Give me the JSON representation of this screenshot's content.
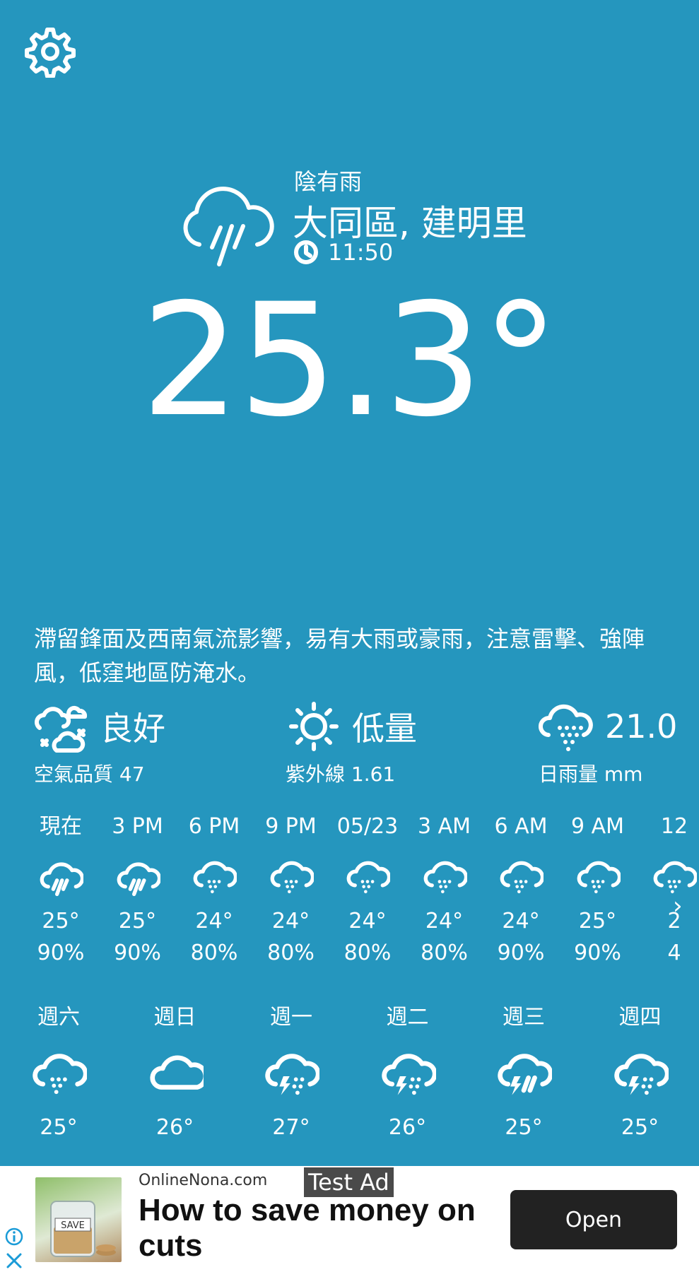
{
  "header": {
    "settings_icon": "gear-icon"
  },
  "current": {
    "condition": "陰有雨",
    "location": "大同區, 建明里",
    "time": "11:50",
    "temperature": "25.3°",
    "icon": "cloud-rain-icon"
  },
  "forecast_text": "滯留鋒面及西南氣流影響，易有大雨或豪雨，注意雷擊、強陣風，低窪地區防淹水。",
  "stats": {
    "air_quality": {
      "value": "良好",
      "label": "空氣品質 47",
      "icon": "air-quality-icon"
    },
    "uv": {
      "value": "低量",
      "label": "紫外線 1.61",
      "icon": "sun-icon"
    },
    "rain": {
      "value": "21.0",
      "label": "日雨量 mm",
      "icon": "cloud-rain-dots-icon"
    }
  },
  "hourly": [
    {
      "time": "現在",
      "temp": "25°",
      "pop": "90%",
      "icon": "cloud-rain-icon"
    },
    {
      "time": "3 PM",
      "temp": "25°",
      "pop": "90%",
      "icon": "cloud-rain-icon"
    },
    {
      "time": "6 PM",
      "temp": "24°",
      "pop": "80%",
      "icon": "cloud-drizzle-icon"
    },
    {
      "time": "9 PM",
      "temp": "24°",
      "pop": "80%",
      "icon": "cloud-drizzle-icon"
    },
    {
      "time": "05/23",
      "temp": "24°",
      "pop": "80%",
      "icon": "cloud-drizzle-icon"
    },
    {
      "time": "3 AM",
      "temp": "24°",
      "pop": "80%",
      "icon": "cloud-drizzle-icon"
    },
    {
      "time": "6 AM",
      "temp": "24°",
      "pop": "90%",
      "icon": "cloud-drizzle-icon"
    },
    {
      "time": "9 AM",
      "temp": "25°",
      "pop": "90%",
      "icon": "cloud-drizzle-icon"
    },
    {
      "time": "12",
      "temp": "2",
      "pop": "4",
      "icon": "cloud-drizzle-icon"
    }
  ],
  "daily": [
    {
      "day": "週六",
      "temp": "25°",
      "icon": "cloud-drizzle-icon"
    },
    {
      "day": "週日",
      "temp": "26°",
      "icon": "cloud-icon"
    },
    {
      "day": "週一",
      "temp": "27°",
      "icon": "cloud-storm-icon"
    },
    {
      "day": "週二",
      "temp": "26°",
      "icon": "cloud-storm-icon"
    },
    {
      "day": "週三",
      "temp": "25°",
      "icon": "cloud-storm-rain-icon"
    },
    {
      "day": "週四",
      "temp": "25°",
      "icon": "cloud-storm-icon"
    }
  ],
  "ad": {
    "site": "OnlineNona.com",
    "badge": "Test Ad",
    "headline": "How to save money on cuts",
    "cta": "Open",
    "thumb_text": "SAVE"
  }
}
